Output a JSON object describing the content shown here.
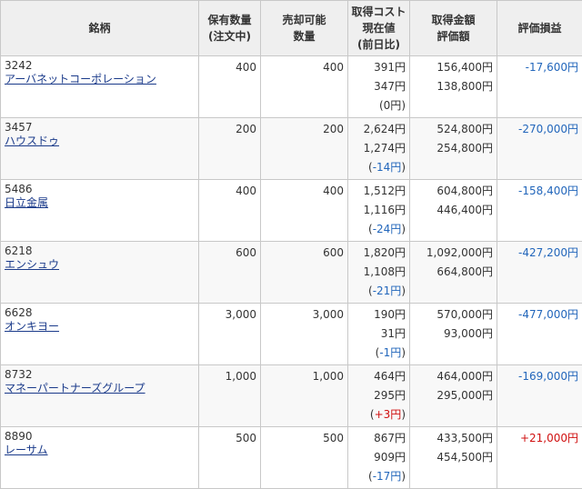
{
  "header": {
    "name": "銘柄",
    "holdings_line1": "保有数量",
    "holdings_line2": "(注文中)",
    "sellable_line1": "売却可能",
    "sellable_line2": "数量",
    "cost_line1": "取得コスト",
    "cost_line2": "現在値",
    "cost_line3": "(前日比)",
    "amount_line1": "取得金額",
    "amount_line2": "評価額",
    "pnl": "評価損益"
  },
  "rows": [
    {
      "code": "3242",
      "name": "アーバネットコーポレーション",
      "holdings": "400",
      "sellable": "400",
      "cost": "391円",
      "price": "347円",
      "change_prefix": "(",
      "change": "0円",
      "change_suffix": ")",
      "change_sign": "zero",
      "acq_amount": "156,400円",
      "eval_amount": "138,800円",
      "pnl": "-17,600円",
      "pnl_sign": "neg"
    },
    {
      "code": "3457",
      "name": "ハウスドゥ",
      "holdings": "200",
      "sellable": "200",
      "cost": "2,624円",
      "price": "1,274円",
      "change_prefix": "(",
      "change": "-14円",
      "change_suffix": ")",
      "change_sign": "neg",
      "acq_amount": "524,800円",
      "eval_amount": "254,800円",
      "pnl": "-270,000円",
      "pnl_sign": "neg"
    },
    {
      "code": "5486",
      "name": "日立金属",
      "holdings": "400",
      "sellable": "400",
      "cost": "1,512円",
      "price": "1,116円",
      "change_prefix": "(",
      "change": "-24円",
      "change_suffix": ")",
      "change_sign": "neg",
      "acq_amount": "604,800円",
      "eval_amount": "446,400円",
      "pnl": "-158,400円",
      "pnl_sign": "neg"
    },
    {
      "code": "6218",
      "name": "エンシュウ",
      "holdings": "600",
      "sellable": "600",
      "cost": "1,820円",
      "price": "1,108円",
      "change_prefix": "(",
      "change": "-21円",
      "change_suffix": ")",
      "change_sign": "neg",
      "acq_amount": "1,092,000円",
      "eval_amount": "664,800円",
      "pnl": "-427,200円",
      "pnl_sign": "neg"
    },
    {
      "code": "6628",
      "name": "オンキヨー",
      "holdings": "3,000",
      "sellable": "3,000",
      "cost": "190円",
      "price": "31円",
      "change_prefix": "(",
      "change": "-1円",
      "change_suffix": ")",
      "change_sign": "neg",
      "acq_amount": "570,000円",
      "eval_amount": "93,000円",
      "pnl": "-477,000円",
      "pnl_sign": "neg"
    },
    {
      "code": "8732",
      "name": "マネーパートナーズグループ",
      "holdings": "1,000",
      "sellable": "1,000",
      "cost": "464円",
      "price": "295円",
      "change_prefix": "(",
      "change": "+3円",
      "change_suffix": ")",
      "change_sign": "pos",
      "acq_amount": "464,000円",
      "eval_amount": "295,000円",
      "pnl": "-169,000円",
      "pnl_sign": "neg"
    },
    {
      "code": "8890",
      "name": "レーサム",
      "holdings": "500",
      "sellable": "500",
      "cost": "867円",
      "price": "909円",
      "change_prefix": "(",
      "change": "-17円",
      "change_suffix": ")",
      "change_sign": "neg",
      "acq_amount": "433,500円",
      "eval_amount": "454,500円",
      "pnl": "+21,000円",
      "pnl_sign": "pos"
    }
  ],
  "colors": {
    "negative": "#2266bb",
    "positive": "#d01010",
    "link": "#1a3a8a",
    "header_bg": "#efefef"
  }
}
